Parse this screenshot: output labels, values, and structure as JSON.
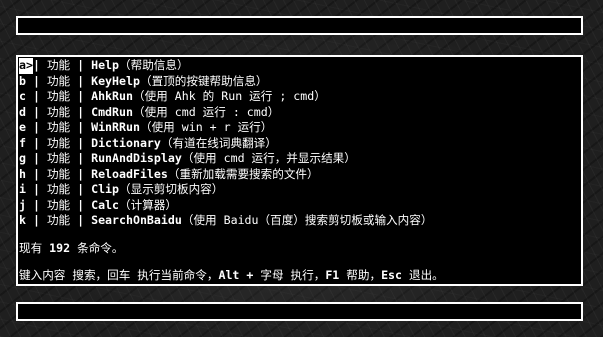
{
  "input": {
    "value": ""
  },
  "commands": [
    {
      "key": "a>",
      "type": "功能",
      "name": "Help",
      "desc": "（帮助信息）",
      "selected": true
    },
    {
      "key": "b ",
      "type": "功能",
      "name": "KeyHelp",
      "desc": "（置顶的按键帮助信息）",
      "selected": false
    },
    {
      "key": "c ",
      "type": "功能",
      "name": "AhkRun",
      "desc": "（使用 Ahk 的 Run 运行 ; cmd）",
      "selected": false
    },
    {
      "key": "d ",
      "type": "功能",
      "name": "CmdRun",
      "desc": "（使用 cmd 运行 : cmd）",
      "selected": false
    },
    {
      "key": "e ",
      "type": "功能",
      "name": "WinRRun",
      "desc": "（使用 win + r 运行）",
      "selected": false
    },
    {
      "key": "f ",
      "type": "功能",
      "name": "Dictionary",
      "desc": "（有道在线词典翻译）",
      "selected": false
    },
    {
      "key": "g ",
      "type": "功能",
      "name": "RunAndDisplay",
      "desc": "（使用 cmd 运行，并显示结果）",
      "selected": false
    },
    {
      "key": "h ",
      "type": "功能",
      "name": "ReloadFiles",
      "desc": "（重新加载需要搜索的文件）",
      "selected": false
    },
    {
      "key": "i ",
      "type": "功能",
      "name": "Clip",
      "desc": "（显示剪切板内容）",
      "selected": false
    },
    {
      "key": "j ",
      "type": "功能",
      "name": "Calc",
      "desc": "（计算器）",
      "selected": false
    },
    {
      "key": "k ",
      "type": "功能",
      "name": "SearchOnBaidu",
      "desc": "（使用 Baidu（百度）搜索剪切板或输入内容）",
      "selected": false
    }
  ],
  "summary": {
    "count_prefix": "现有 ",
    "count": "192",
    "count_suffix": " 条命令。"
  },
  "help": {
    "p1": "键入内容 搜索，回车 执行当前命令，",
    "k1": "Alt + ",
    "p2": "字母 执行，",
    "k2": "F1 ",
    "p3": "帮助，",
    "k3": "Esc ",
    "p4": "退出。"
  },
  "status": {
    "value": ""
  }
}
